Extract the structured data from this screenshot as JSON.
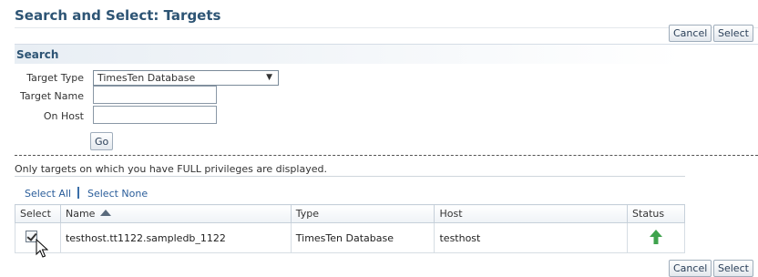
{
  "page": {
    "title": "Search and Select: Targets"
  },
  "toolbar_top": {
    "cancel_label": "Cancel",
    "select_label": "Select"
  },
  "search": {
    "heading": "Search",
    "target_type_label": "Target Type",
    "target_type_value": "TimesTen Database",
    "target_name_label": "Target Name",
    "target_name_value": "",
    "on_host_label": "On Host",
    "on_host_value": "",
    "go_label": "Go"
  },
  "results": {
    "note": "Only targets on which you have FULL privileges are displayed.",
    "select_all_label": "Select All",
    "select_none_label": "Select None",
    "columns": {
      "select": "Select",
      "name": "Name",
      "type": "Type",
      "host": "Host",
      "status": "Status"
    },
    "rows": [
      {
        "selected": true,
        "name": "testhost.tt1122.sampledb_1122",
        "type": "TimesTen Database",
        "host": "testhost",
        "status": "up"
      }
    ]
  },
  "toolbar_bottom": {
    "cancel_label": "Cancel",
    "select_label": "Select"
  },
  "icons": {
    "status_up": "arrow-up-icon",
    "sort": "sort-ascending-icon",
    "cursor": "mouse-pointer-icon"
  },
  "colors": {
    "title": "#2d5474",
    "link": "#2a5d9a",
    "status_up": "#3fa34d"
  }
}
